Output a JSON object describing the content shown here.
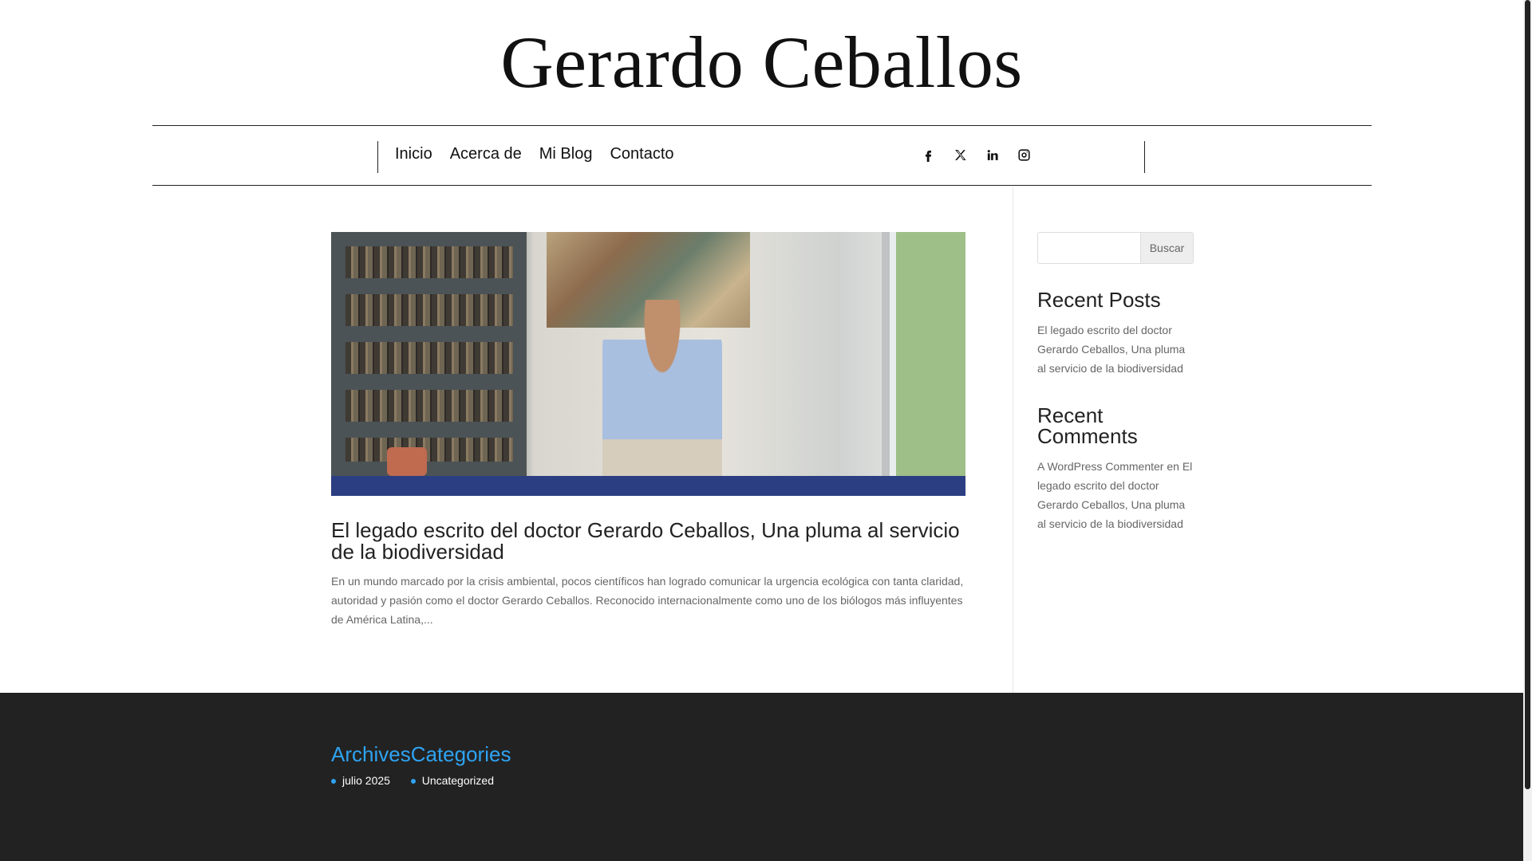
{
  "site": {
    "title": "Gerardo Ceballos"
  },
  "nav": {
    "menu": [
      "Inicio",
      "Acerca de",
      "Mi Blog",
      "Contacto"
    ],
    "social_icons": [
      "facebook-icon",
      "x-icon",
      "linkedin-icon",
      "instagram-icon"
    ]
  },
  "post": {
    "title": "El legado escrito del doctor Gerardo Ceballos, Una pluma al servicio de la biodiversidad",
    "excerpt": "En un mundo marcado por la crisis ambiental, pocos científicos han logrado comunicar la urgencia ecológica con tanta claridad, autoridad y pasión como el doctor Gerardo Ceballos. Reconocido internacionalmente como uno de los biólogos más influyentes de América Latina,..."
  },
  "sidebar": {
    "search": {
      "placeholder": "",
      "button_label": "Buscar"
    },
    "recent_posts": {
      "title": "Recent Posts",
      "items": [
        "El legado escrito del doctor Gerardo Ceballos, Una pluma al servicio de la biodiversidad"
      ]
    },
    "recent_comments": {
      "title": "Recent Comments",
      "author": "A WordPress Commenter",
      "connector": "en",
      "post": "El legado escrito del doctor Gerardo Ceballos, Una pluma al servicio de la biodiversidad"
    }
  },
  "footer": {
    "archives": {
      "title": "Archives",
      "items": [
        "julio 2025"
      ]
    },
    "categories": {
      "title": "Categories",
      "items": [
        "Uncategorized"
      ]
    }
  },
  "colors": {
    "accent": "#2ea3f2",
    "footer_bg": "#222222",
    "text_muted": "#666666"
  }
}
